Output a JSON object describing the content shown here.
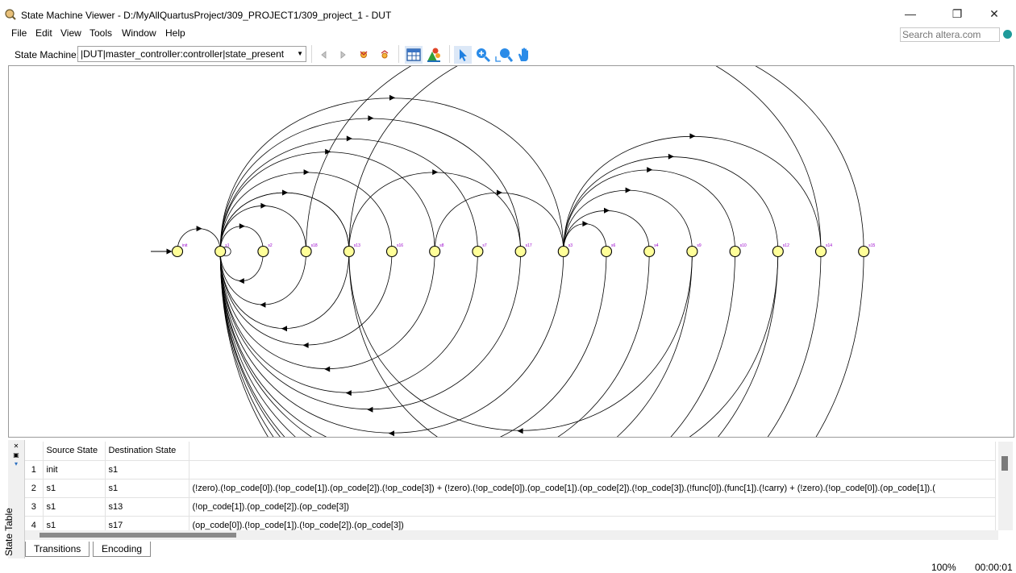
{
  "window": {
    "title": "State Machine Viewer - D:/MyAllQuartusProject/309_PROJECT1/309_project_1 - DUT",
    "minimize_glyph": "—",
    "restore_glyph": "❐",
    "close_glyph": "✕"
  },
  "menu": [
    "File",
    "Edit",
    "View",
    "Tools",
    "Window",
    "Help"
  ],
  "search": {
    "placeholder": "Search altera.com"
  },
  "toolbar": {
    "state_machine_label": "State Machine:",
    "state_machine_value": "|DUT|master_controller:controller|state_present",
    "icons": [
      "back-icon",
      "forward-icon",
      "expand-icon",
      "collapse-icon",
      "table-icon",
      "tree-icon",
      "pointer-icon",
      "zoom-in-icon",
      "zoom-fit-icon",
      "pan-hand-icon"
    ]
  },
  "diagram": {
    "states": [
      "init",
      "s1",
      "s2",
      "s18",
      "s13",
      "s16",
      "s8",
      "s7",
      "s17",
      "s3",
      "s6",
      "s4",
      "s9",
      "s10",
      "s12",
      "s14",
      "s15"
    ],
    "arcs_above": [
      [
        0,
        1
      ],
      [
        1,
        2
      ],
      [
        1,
        3
      ],
      [
        1,
        4
      ],
      [
        1,
        5
      ],
      [
        1,
        6
      ],
      [
        1,
        7
      ],
      [
        1,
        8
      ],
      [
        1,
        9
      ],
      [
        1,
        4
      ],
      [
        4,
        8
      ],
      [
        9,
        10
      ],
      [
        9,
        11
      ],
      [
        9,
        12
      ],
      [
        9,
        13
      ],
      [
        9,
        14
      ],
      [
        9,
        15
      ],
      [
        3,
        15
      ],
      [
        6,
        9
      ],
      [
        4,
        16
      ]
    ],
    "arcs_below": [
      [
        2,
        1
      ],
      [
        3,
        1
      ],
      [
        4,
        1
      ],
      [
        5,
        1
      ],
      [
        6,
        1
      ],
      [
        7,
        1
      ],
      [
        8,
        1
      ],
      [
        9,
        1
      ],
      [
        10,
        1
      ],
      [
        11,
        1
      ],
      [
        12,
        1
      ],
      [
        13,
        1
      ],
      [
        14,
        1
      ],
      [
        15,
        1
      ],
      [
        16,
        1
      ],
      [
        12,
        4
      ],
      [
        14,
        4
      ]
    ],
    "colors": {
      "node_fill": "#ffff99",
      "node_stroke": "#000000",
      "label": "#9900cc",
      "edge": "#000000"
    }
  },
  "panel": {
    "title": "State Table",
    "columns": [
      "Source State",
      "Destination State",
      ""
    ],
    "rows": [
      {
        "num": "1",
        "source": "init",
        "destination": "s1",
        "condition": ""
      },
      {
        "num": "2",
        "source": "s1",
        "destination": "s1",
        "condition": "(!zero).(!op_code[0]).(!op_code[1]).(op_code[2]).(!op_code[3]) + (!zero).(!op_code[0]).(op_code[1]).(op_code[2]).(!op_code[3]).(!func[0]).(func[1]).(!carry) + (!zero).(!op_code[0]).(op_code[1]).("
      },
      {
        "num": "3",
        "source": "s1",
        "destination": "s13",
        "condition": "(!op_code[1]).(op_code[2]).(op_code[3])"
      },
      {
        "num": "4",
        "source": "s1",
        "destination": "s17",
        "condition": "(op_code[0]).(!op_code[1]).(!op_code[2]).(op_code[3])"
      }
    ],
    "tabs": [
      "Transitions",
      "Encoding"
    ]
  },
  "status": {
    "zoom": "100%",
    "time": "00:00:01"
  }
}
